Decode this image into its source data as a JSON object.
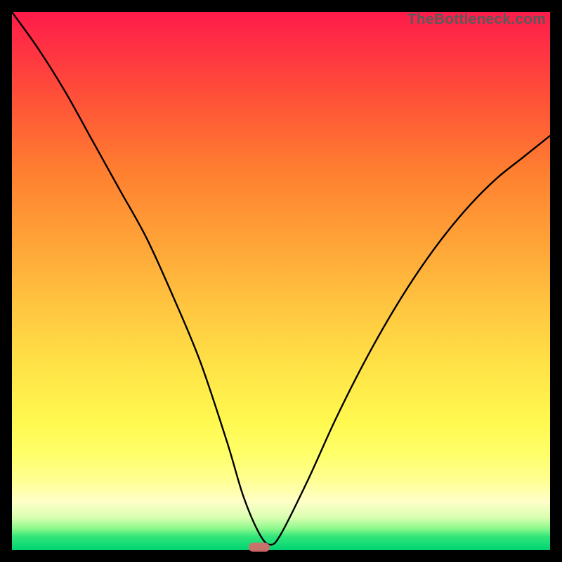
{
  "watermark": "TheBottleneck.com",
  "chart_data": {
    "type": "line",
    "title": "",
    "xlabel": "",
    "ylabel": "",
    "xlim": [
      0,
      100
    ],
    "ylim": [
      0,
      100
    ],
    "grid": false,
    "legend_position": "none",
    "series": [
      {
        "name": "curve",
        "x": [
          0,
          5,
          10,
          15,
          20,
          25,
          30,
          35,
          40,
          43,
          46,
          48,
          50,
          55,
          60,
          65,
          70,
          75,
          80,
          85,
          90,
          95,
          100
        ],
        "y": [
          100,
          93,
          85,
          76,
          67,
          58,
          47,
          35,
          20,
          10,
          3,
          1,
          3,
          13,
          24,
          34,
          43,
          51,
          58,
          64,
          69,
          73,
          77
        ]
      }
    ],
    "marker": {
      "x": 46,
      "y": 0.5
    },
    "gradient_background": {
      "top": "#ff1b4a",
      "mid": "#ffe347",
      "bottom": "#00d472"
    }
  }
}
